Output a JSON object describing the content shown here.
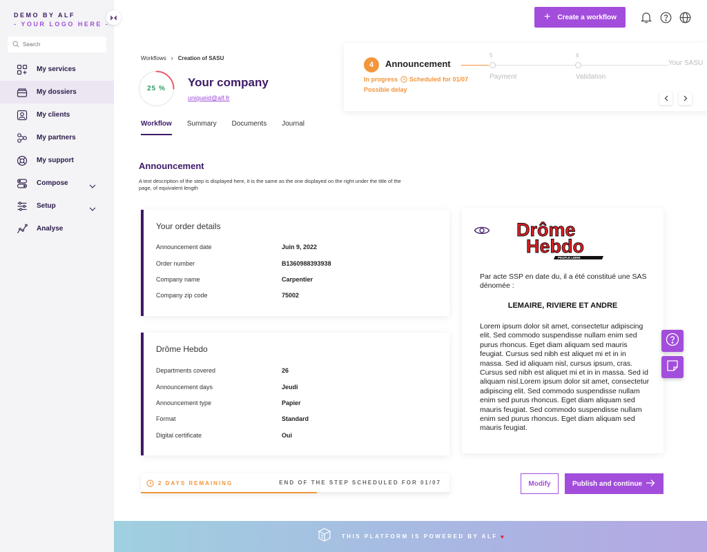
{
  "brand": {
    "line1": "DEMO BY ALF",
    "line2": "- YOUR LOGO HERE -"
  },
  "sidebar": {
    "search_placeholder": "Search",
    "items": [
      {
        "label": "My services"
      },
      {
        "label": "My dossiers"
      },
      {
        "label": "My clients"
      },
      {
        "label": "My partners"
      },
      {
        "label": "My support"
      },
      {
        "label": "Compose"
      },
      {
        "label": "Setup"
      },
      {
        "label": "Analyse"
      }
    ]
  },
  "topbar": {
    "create_label": "Create a workflow"
  },
  "breadcrumb": {
    "root": "Workflows",
    "current": "Creation of SASU"
  },
  "company": {
    "progress": "25 %",
    "progress_fraction": 0.25,
    "name": "Your company",
    "email": "uniqueid@alf.fr"
  },
  "tabs": [
    "Workflow",
    "Summary",
    "Documents",
    "Journal"
  ],
  "stepper": {
    "number": "4",
    "title": "Announcement",
    "status": "In progress",
    "scheduled": "Scheduled for 01/07",
    "delay": "Possible delay",
    "next": [
      {
        "num": "5",
        "label": "Payment"
      },
      {
        "num": "6",
        "label": "Validation"
      },
      {
        "num": "",
        "label": "Your SASU"
      }
    ]
  },
  "section": {
    "title": "Announcement",
    "desc": "A text description of the step is displayed here, it is the same as the one displayed on the right under the title of the page, of equivalent length"
  },
  "order": {
    "title": "Your order details",
    "rows": [
      {
        "k": "Announcement date",
        "v": "Juin 9, 2022"
      },
      {
        "k": "Order number",
        "v": "B1360988393938"
      },
      {
        "k": "Company name",
        "v": "Carpentier"
      },
      {
        "k": "Company zip code",
        "v": "75002"
      }
    ]
  },
  "journal": {
    "title": "Drôme Hebdo",
    "rows": [
      {
        "k": "Departments covered",
        "v": "26"
      },
      {
        "k": "Announcement days",
        "v": "Jeudi"
      },
      {
        "k": "Announcement type",
        "v": "Papier"
      },
      {
        "k": "Format",
        "v": "Standard"
      },
      {
        "k": "Digital certificate",
        "v": "Oui"
      }
    ]
  },
  "paper": {
    "logo_line1": "Drôme",
    "logo_line2": "Hebdo",
    "logo_tag": "PEUPLE LIBRE",
    "intro": "Par acte SSP en date du, il a été constitué une SAS dénomée :",
    "company": "LEMAIRE, RIVIERE ET ANDRE",
    "body": "Lorem ipsum dolor sit amet, consectetur adipiscing elit. Sed commodo suspendisse nullam enim sed purus rhoncus. Eget diam aliquam sed mauris feugiat. Cursus sed nibh est aliquet mi et in in massa. Sed id aliquam nisl, cursus ipsum, cras. Cursus sed nibh est aliquet mi et in in massa. Sed id aliquam nisl.Lorem ipsum dolor sit amet, consectetur adipiscing elit. Sed commodo suspendisse nullam enim sed purus rhoncus. Eget diam aliquam sed mauris feugiat.  Sed commodo suspendisse nullam enim sed purus rhoncus. Eget diam aliquam sed mauris feugiat."
  },
  "actions": {
    "remaining": "2 DAYS REMAINING",
    "end_step": "END OF THE STEP SCHEDULED FOR 01/07",
    "remaining_fraction": 0.57,
    "modify": "Modify",
    "publish": "Publish and continue"
  },
  "footer": {
    "text": "THIS PLATFORM IS POWERED BY ALF",
    "heart": "♥"
  },
  "colors": {
    "accent": "#a24ddb",
    "dark": "#3d1a66",
    "orange": "#f3953a",
    "green": "#2e9b64"
  }
}
